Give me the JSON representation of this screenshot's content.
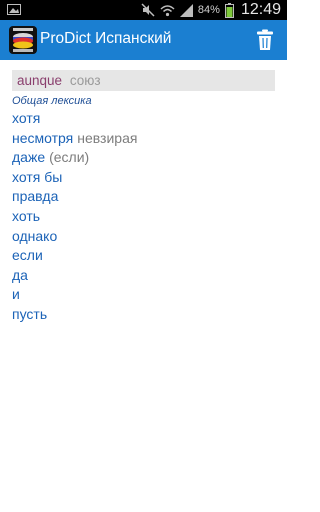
{
  "status_bar": {
    "battery_percent": "84%",
    "time": "12:49",
    "icons": [
      "gallery-icon",
      "mute-icon",
      "wifi-icon",
      "signal-icon",
      "battery-icon"
    ]
  },
  "app_bar": {
    "title": "ProDict Испанский",
    "logo_icon": "prodict-logo-icon",
    "action_icon": "trash-icon",
    "color": "#1b7fd1"
  },
  "entry": {
    "headword": "aunque",
    "part_of_speech": "союз",
    "category": "Общая лексика",
    "translations": [
      {
        "word": "хотя",
        "note": ""
      },
      {
        "word": "несмотря",
        "note": "невзирая"
      },
      {
        "word": "даже",
        "note": "(если)"
      },
      {
        "word": "хотя бы",
        "note": ""
      },
      {
        "word": "правда",
        "note": ""
      },
      {
        "word": "хоть",
        "note": ""
      },
      {
        "word": "однако",
        "note": ""
      },
      {
        "word": "если",
        "note": ""
      },
      {
        "word": "да",
        "note": ""
      },
      {
        "word": "и",
        "note": ""
      },
      {
        "word": "пусть",
        "note": ""
      }
    ]
  }
}
